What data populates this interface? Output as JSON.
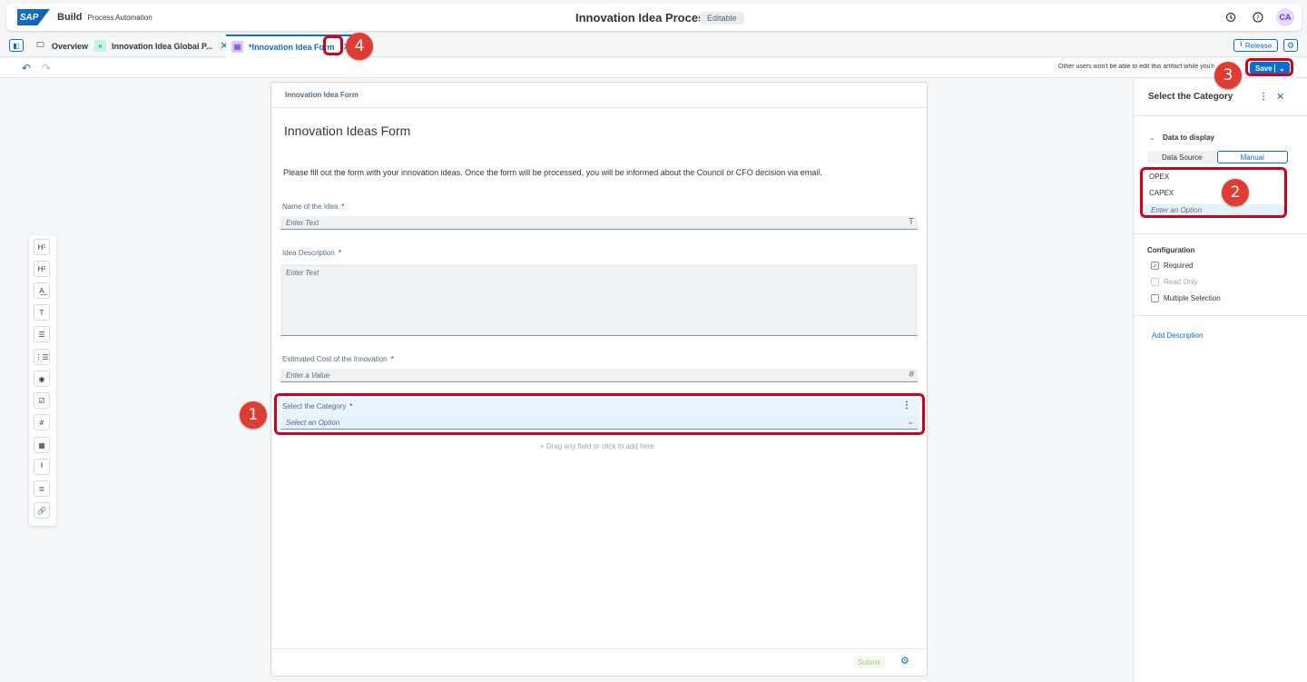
{
  "shell": {
    "logo": "SAP",
    "brand": "Build",
    "product": "Process Automation",
    "title": "Innovation Idea Process",
    "status_badge": "Editable",
    "avatar_initials": "CA"
  },
  "tabs": [
    {
      "label": "Overview"
    },
    {
      "label": "Innovation Idea Global P..."
    },
    {
      "label": "*Innovation Idea Form"
    }
  ],
  "tabbar": {
    "release_label": "Release"
  },
  "toolbar": {
    "notice": "Other users won't be able to edit this artifact while you're e",
    "save_label": "Save"
  },
  "palette": {
    "items": [
      "H1",
      "H2",
      "Paragraph",
      "Text",
      "Text Area",
      "Dropdown",
      "Radio",
      "Checkbox",
      "Number",
      "Date",
      "Upload",
      "List",
      "Link"
    ]
  },
  "form": {
    "header": "Innovation Idea Form",
    "title": "Innovation Ideas Form",
    "description": "Please fill out the form with your innovation ideas. Once the form will be processed, you will be informed about the Council or CFO decision via email.",
    "fields": {
      "name_label": "Name of the Idea",
      "name_placeholder": "Enter Text",
      "desc_label": "Idea Description",
      "desc_placeholder": "Enter Text",
      "cost_label": "Estimated Cost of the Innovation",
      "cost_placeholder": "Enter a Value",
      "category_label": "Select the Category",
      "category_placeholder": "Select an Option",
      "required_marker": "*"
    },
    "drop_hint": "Drag any field or click to add here",
    "submit_label": "Submit"
  },
  "panel": {
    "title": "Select the Category",
    "data_section": "Data to display",
    "segments": [
      "Data Source",
      "Manual"
    ],
    "options": [
      "OPEX",
      "CAPEX"
    ],
    "option_placeholder": "Enter an Option",
    "config_title": "Configuration",
    "checkboxes": [
      {
        "label": "Required",
        "checked": true
      },
      {
        "label": "Read Only",
        "checked": false
      },
      {
        "label": "Multiple Selection",
        "checked": false
      }
    ],
    "add_description": "Add Description"
  },
  "annotations": [
    "1",
    "2",
    "3",
    "4"
  ],
  "colors": {
    "accent": "#0a6ed1",
    "highlight": "#d0021b",
    "marker": "#e03c31"
  }
}
